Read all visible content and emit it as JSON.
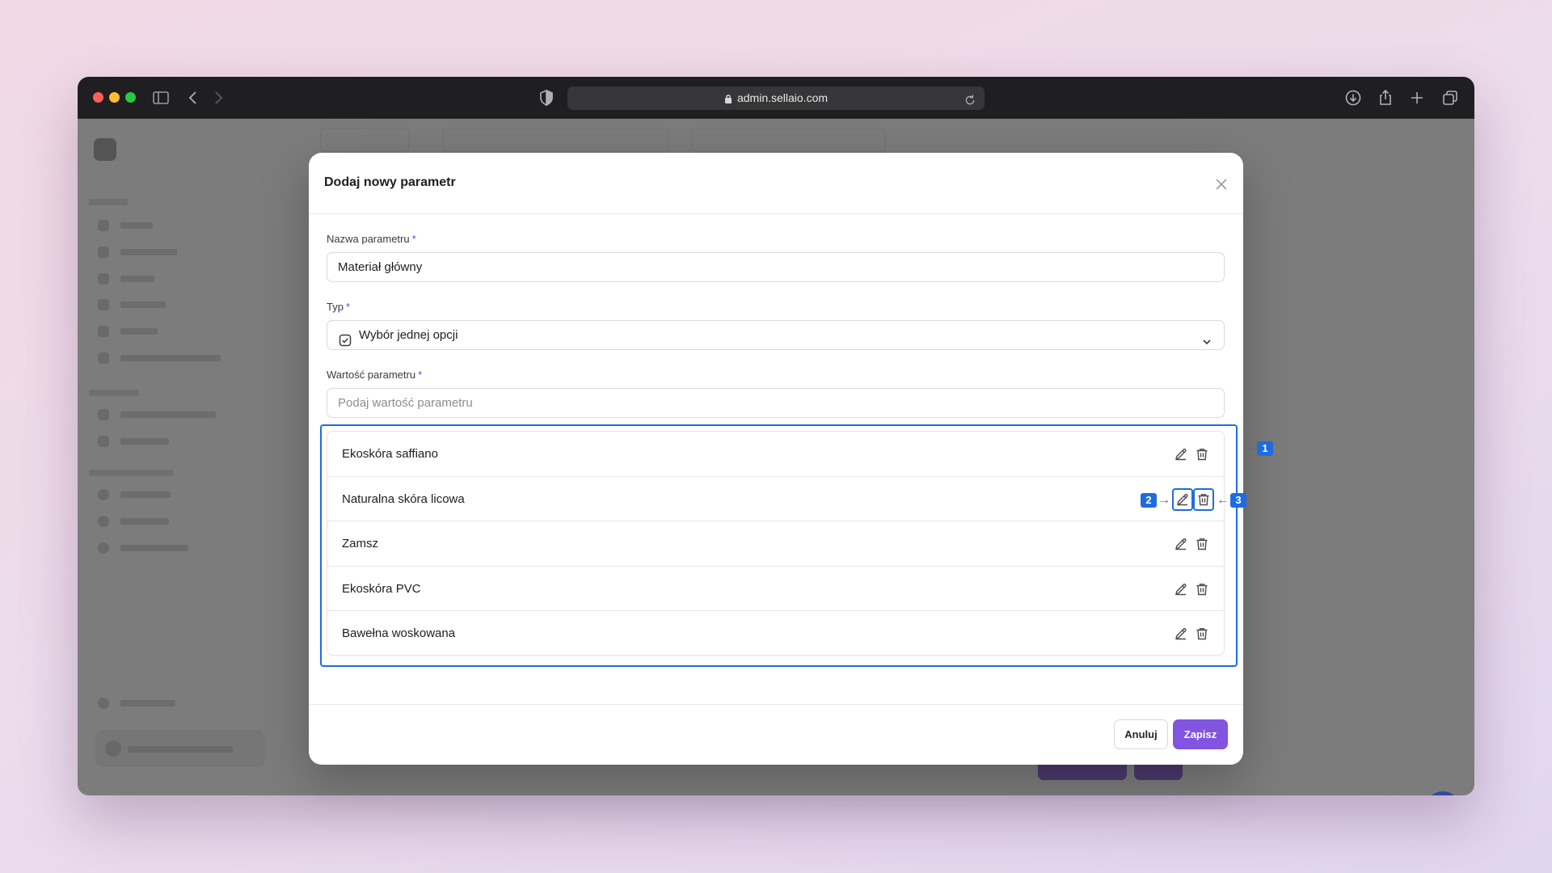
{
  "browser": {
    "url": "admin.sellaio.com"
  },
  "modal": {
    "title": "Dodaj nowy parametr",
    "name_field": {
      "label": "Nazwa parametru",
      "required_mark": "*",
      "value": "Materiał główny"
    },
    "type_field": {
      "label": "Typ",
      "required_mark": "*",
      "selected": "Wybór jednej opcji",
      "icon": "checkbox-icon"
    },
    "value_field": {
      "label": "Wartość parametru",
      "required_mark": "*",
      "placeholder": "Podaj wartość parametru",
      "value": ""
    },
    "values": [
      {
        "label": "Ekoskóra saffiano"
      },
      {
        "label": "Naturalna skóra licowa"
      },
      {
        "label": "Zamsz"
      },
      {
        "label": "Ekoskóra PVC"
      },
      {
        "label": "Bawełna woskowana"
      }
    ],
    "footer": {
      "cancel_label": "Anuluj",
      "save_label": "Zapisz"
    }
  },
  "annotations": {
    "badge_1": "1",
    "badge_2": "2",
    "badge_3": "3",
    "color": "#1e6ce0"
  },
  "colors": {
    "accent": "#8155e0",
    "highlight": "#1e6ce0"
  }
}
